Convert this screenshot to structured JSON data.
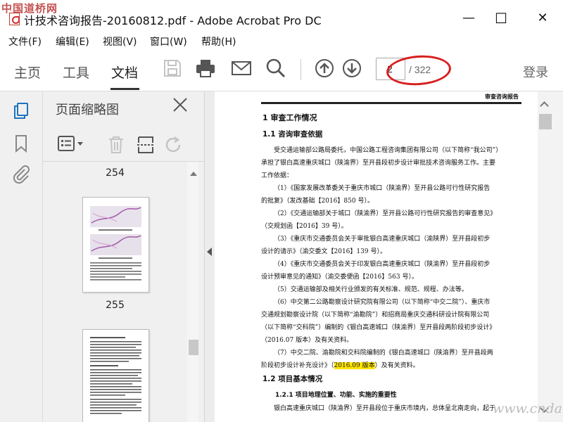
{
  "watermark": "中国道桥网",
  "watermark_bottom": "www.cndao.com",
  "window": {
    "title": "计技术咨询报告-20160812.pdf - Adobe Acrobat Pro DC",
    "minimize": "—",
    "maximize": "☐",
    "close": "✕"
  },
  "menu": [
    "文件(F)",
    "编辑(E)",
    "视图(V)",
    "窗口(W)",
    "帮助(H)"
  ],
  "tabs": [
    "主页",
    "工具",
    "文档"
  ],
  "page_nav": {
    "current": "2",
    "total": "/ 322"
  },
  "login": "登录",
  "panel": {
    "title": "页面缩略图",
    "pages": [
      "254",
      "255"
    ]
  },
  "document": {
    "running_head": "审查咨询报告",
    "heading1": "1 审查工作情况",
    "heading1_1": "1.1 咨询审查依据",
    "para_lines": [
      "受交通运输部公路局委托，中国公路工程咨询集团有限公司（以下简称“我公司”）",
      "承担了银白高速重庆城口（陕渝界）至开县段初步设计审批技术咨询服务工作。主要",
      "工作依据：",
      "（1）《国家发展改革委关于重庆市城口（陕渝界）至开县公路可行性研究报告",
      "的批复》（发改基础【2016】850 号）。",
      "（2）《交通运输部关于城口（陕渝界）至开县公路可行性研究报告的审查意见》",
      "（交规划函【2016】39 号）。",
      "（3）《重庆市交通委员会关于审批银白高速重庆城口（渝陕界）至开县段初步",
      "设计的请示》（渝交委文【2016】139 号）。",
      "（4）《重庆市交通委员会关于印发银白高速重庆城口（陕渝界）至开县段初步",
      "设计预审意见的通知》（渝交委便函【2016】563 号）。",
      "（5）交通运输部及相关行业颁发的有关标准、规范、规程、办法等。",
      "（6）中交第二公路勘察设计研究院有限公司（以下简称“中交二院”）、重庆市",
      "交通规划勘察设计院（以下简称“渝勘院”）和招商局重庆交通科研设计院有限公司",
      "（以下简称“交科院”）编制的《银白高速城口（陕渝界）至开县段两阶段初步设计》",
      "（2016.07 版本）及有关资料。",
      "（7）中交二院、渝勘院和交科院编制的《银白高速城口（陕渝界）至开县段两",
      "阶段初步设计补充设计》（",
      "2016.09 版本",
      "）及有关资料。"
    ],
    "heading1_2": "1.2 项目基本情况",
    "heading1_2_1": "1.2.1 项目地理位置、功能、实施的重要性",
    "last_line": "银白高速重庆城口（陕渝界）至开县段位于重庆市境内，总体呈北南走向，起于"
  },
  "colors": {
    "accent": "#1e73be",
    "annotation": "#d81e1e",
    "highlight": "#ffe600"
  }
}
